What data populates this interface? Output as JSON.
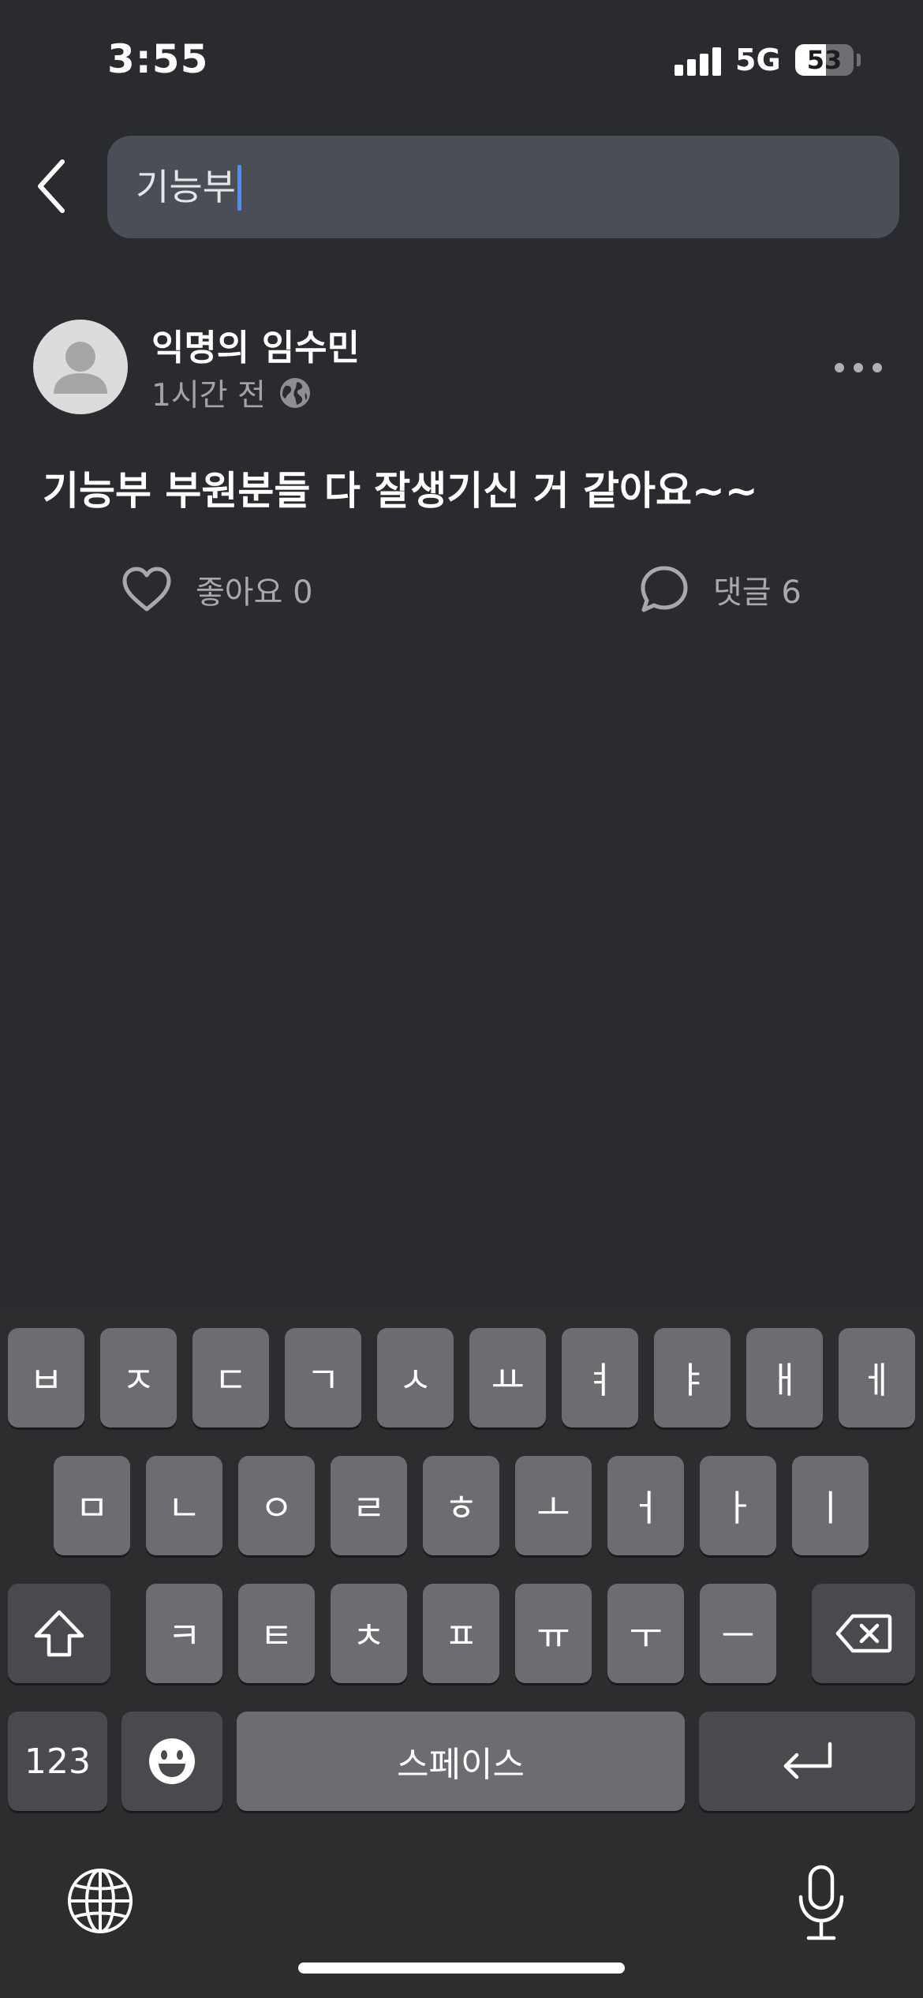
{
  "status_bar": {
    "time": "3:55",
    "network": "5G",
    "battery": "53",
    "battery_level": 0.53
  },
  "search": {
    "value": "기능부"
  },
  "post": {
    "author": "익명의 임수민",
    "time_ago": "1시간 전",
    "body": "기능부 부원분들 다 잘생기신 거 같아요~~",
    "like_label": "좋아요 0",
    "comment_label": "댓글 6"
  },
  "keyboard": {
    "row1": [
      "ㅂ",
      "ㅈ",
      "ㄷ",
      "ㄱ",
      "ㅅ",
      "ㅛ",
      "ㅕ",
      "ㅑ",
      "ㅐ",
      "ㅔ"
    ],
    "row2": [
      "ㅁ",
      "ㄴ",
      "ㅇ",
      "ㄹ",
      "ㅎ",
      "ㅗ",
      "ㅓ",
      "ㅏ",
      "ㅣ"
    ],
    "row3": [
      "ㅋ",
      "ㅌ",
      "ㅊ",
      "ㅍ",
      "ㅠ",
      "ㅜ",
      "ㅡ"
    ],
    "numbers_label": "123",
    "space_label": "스페이스"
  },
  "icons": {
    "back": "chevron-left-icon",
    "globe_small": "globe-icon",
    "more": "ellipsis-icon",
    "like": "heart-icon",
    "comment": "speech-bubble-icon",
    "shift": "shift-arrow-icon",
    "delete": "backspace-icon",
    "emoji": "emoji-face-icon",
    "return": "return-arrow-icon",
    "keyboard_globe": "globe-icon",
    "microphone": "microphone-icon"
  },
  "colors": {
    "background": "#2a2b2f",
    "search_field": "#4b4e56",
    "caret": "#4c8dff",
    "key": "#6d6d71",
    "key_dark": "#4a4a4e",
    "secondary_text": "#a2a3a8"
  }
}
